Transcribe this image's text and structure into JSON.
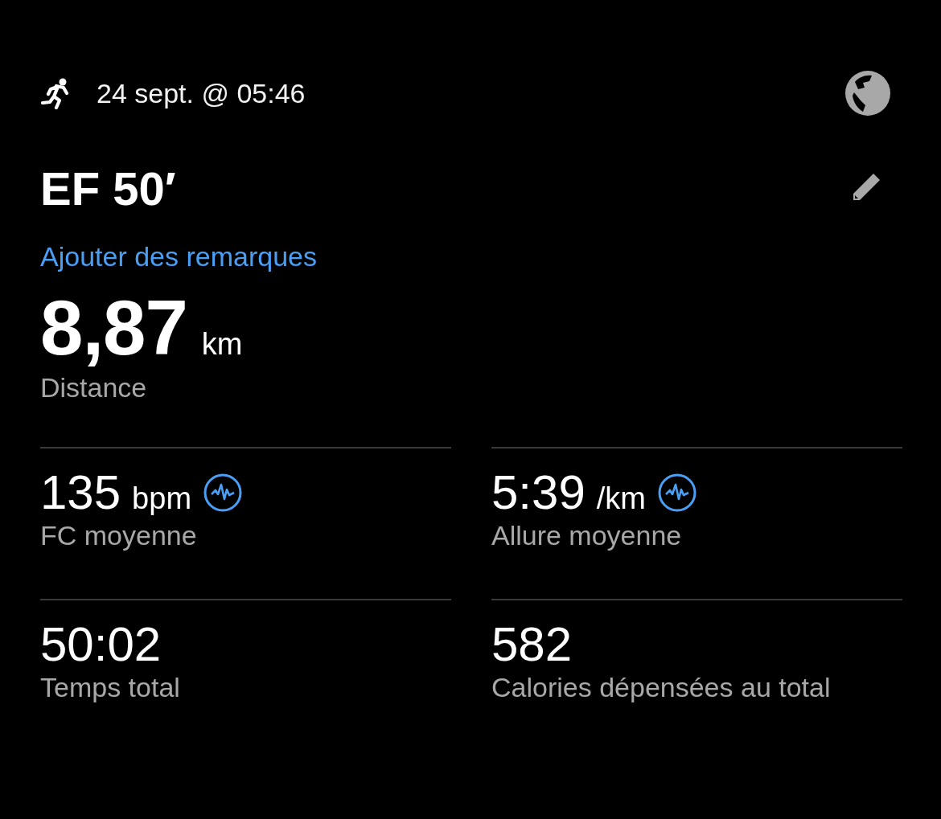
{
  "header": {
    "datetime": "24 sept. @ 05:46"
  },
  "title": "EF 50′",
  "notes_link": "Ajouter des remarques",
  "distance": {
    "value": "8,87",
    "unit": "km",
    "label": "Distance"
  },
  "stats": [
    {
      "value": "135",
      "unit": "bpm",
      "label": "FC moyenne",
      "graph_icon": true
    },
    {
      "value": "5:39",
      "unit": "/km",
      "label": "Allure moyenne",
      "graph_icon": true
    },
    {
      "value": "50:02",
      "label": "Temps total",
      "graph_icon": false
    },
    {
      "value": "582",
      "label": "Calories dépensées au total",
      "graph_icon": false
    }
  ]
}
